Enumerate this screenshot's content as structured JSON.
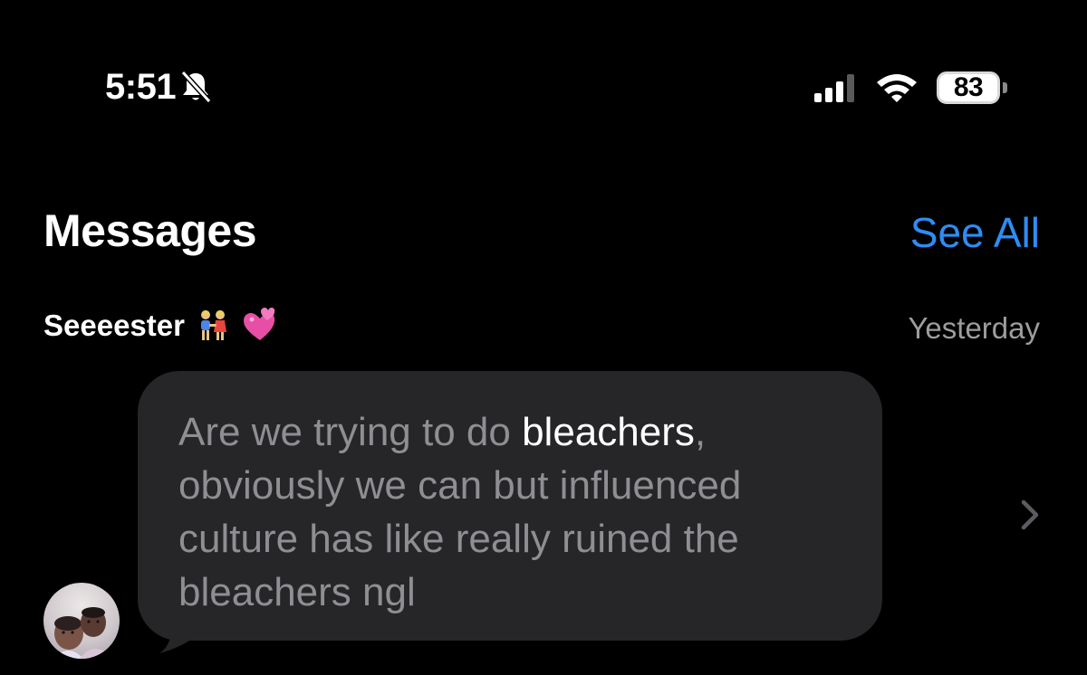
{
  "status_bar": {
    "time": "5:51",
    "battery": "83",
    "icons": [
      "bell-off-icon",
      "signal-icon",
      "wifi-icon",
      "battery-icon"
    ]
  },
  "widget": {
    "title": "Messages",
    "see_all": "See All"
  },
  "conversation": {
    "contact_name": "Seeeester",
    "emoji_1": "people-holding-hands-emoji",
    "emoji_2": "two-hearts-emoji",
    "timestamp": "Yesterday",
    "message": {
      "text_before": "Are we trying to do ",
      "highlight": "bleachers",
      "text_after": ", obviously we can but influenced culture has like really ruined the bleachers ngl"
    }
  },
  "colors": {
    "background": "#000000",
    "link_blue": "#2f8cf3",
    "bubble_bg": "#262628",
    "message_text": "#8e8e93",
    "timestamp": "#9d9d9f"
  }
}
